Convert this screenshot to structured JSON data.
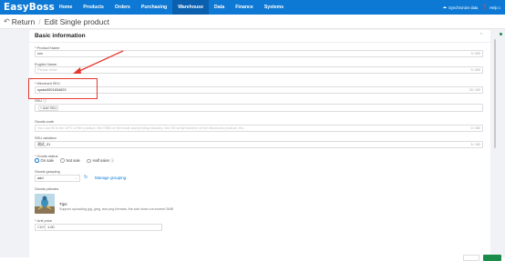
{
  "topnav": {
    "logo": "EasyBoss",
    "items": [
      {
        "label": "Home"
      },
      {
        "label": "Products"
      },
      {
        "label": "Orders"
      },
      {
        "label": "Purchasing"
      },
      {
        "label": "Warehouse",
        "active": true
      },
      {
        "label": "Data"
      },
      {
        "label": "Finance"
      },
      {
        "label": "Systems"
      }
    ],
    "right": {
      "sync_label": "Synchronize data",
      "help_label": "Help c"
    }
  },
  "breadcrumb": {
    "back_label": "Return",
    "separator": "/",
    "title": "Edit Single product"
  },
  "card": {
    "title": "Basic information",
    "collapse_icon": "chevron-up-icon",
    "product_name": {
      "label": "Product Name",
      "value": "cxx",
      "count": "3 / 300"
    },
    "english_name": {
      "label": "English Name",
      "placeholder": "Please enter",
      "count": "0 / 300"
    },
    "merchant_sku": {
      "label": "Merchant SKU",
      "value": "sysbs0001834623",
      "count": "15 / 100"
    },
    "sku": {
      "label": "SKU",
      "add_label": "+ Add SKU"
    },
    "goods_code": {
      "label": "Goods code",
      "placeholder": "You can fill in the UPC of the product, the ISBN of the book and printing industry, the SN serial number of the electronic product, etc.",
      "count": "0 / 100"
    },
    "sku_variation": {
      "label": "SKU variation",
      "value": "测试_01",
      "count": "5 / 100"
    },
    "goods_status": {
      "label": "Goods status",
      "options": [
        {
          "label": "On sale",
          "selected": true
        },
        {
          "label": "Not sale",
          "selected": false
        },
        {
          "label": "Half sales ⓘ",
          "selected": false
        }
      ]
    },
    "goods_grouping": {
      "label": "Goods grouping",
      "value": "add",
      "manage_label": "Manage grouping"
    },
    "goods_pictures": {
      "label": "Goods pictures",
      "tips_title": "Tips",
      "tips_body": "Support uploading jpg, jpeg, and png formats, the size does not exceed 5MB"
    },
    "unit_price": {
      "label": "Unit price",
      "currency": "CNY",
      "value": "1.00"
    }
  },
  "colors": {
    "nav_bg": "#0e79d4",
    "nav_active": "#0a5fae",
    "annotation": "#e8362c",
    "primary_btn": "#1a8c4a"
  }
}
